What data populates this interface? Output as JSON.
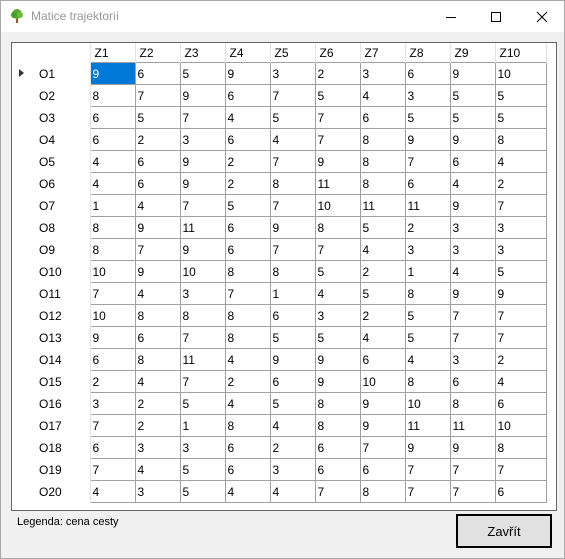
{
  "window": {
    "title": "Matice trajektorií"
  },
  "table": {
    "columns": [
      "Z1",
      "Z2",
      "Z3",
      "Z4",
      "Z5",
      "Z6",
      "Z7",
      "Z8",
      "Z9",
      "Z10"
    ],
    "rows": [
      {
        "label": "O1",
        "values": [
          "9",
          "6",
          "5",
          "9",
          "3",
          "2",
          "3",
          "6",
          "9",
          "10"
        ]
      },
      {
        "label": "O2",
        "values": [
          "8",
          "7",
          "9",
          "6",
          "7",
          "5",
          "4",
          "3",
          "5",
          "5"
        ]
      },
      {
        "label": "O3",
        "values": [
          "6",
          "5",
          "7",
          "4",
          "5",
          "7",
          "6",
          "5",
          "5",
          "5"
        ]
      },
      {
        "label": "O4",
        "values": [
          "6",
          "2",
          "3",
          "6",
          "4",
          "7",
          "8",
          "9",
          "9",
          "8"
        ]
      },
      {
        "label": "O5",
        "values": [
          "4",
          "6",
          "9",
          "2",
          "7",
          "9",
          "8",
          "7",
          "6",
          "4"
        ]
      },
      {
        "label": "O6",
        "values": [
          "4",
          "6",
          "9",
          "2",
          "8",
          "11",
          "8",
          "6",
          "4",
          "2"
        ]
      },
      {
        "label": "O7",
        "values": [
          "1",
          "4",
          "7",
          "5",
          "7",
          "10",
          "11",
          "11",
          "9",
          "7"
        ]
      },
      {
        "label": "O8",
        "values": [
          "8",
          "9",
          "11",
          "6",
          "9",
          "8",
          "5",
          "2",
          "3",
          "3"
        ]
      },
      {
        "label": "O9",
        "values": [
          "8",
          "7",
          "9",
          "6",
          "7",
          "7",
          "4",
          "3",
          "3",
          "3"
        ]
      },
      {
        "label": "O10",
        "values": [
          "10",
          "9",
          "10",
          "8",
          "8",
          "5",
          "2",
          "1",
          "4",
          "5"
        ]
      },
      {
        "label": "O11",
        "values": [
          "7",
          "4",
          "3",
          "7",
          "1",
          "4",
          "5",
          "8",
          "9",
          "9"
        ]
      },
      {
        "label": "O12",
        "values": [
          "10",
          "8",
          "8",
          "8",
          "6",
          "3",
          "2",
          "5",
          "7",
          "7"
        ]
      },
      {
        "label": "O13",
        "values": [
          "9",
          "6",
          "7",
          "8",
          "5",
          "5",
          "4",
          "5",
          "7",
          "7"
        ]
      },
      {
        "label": "O14",
        "values": [
          "6",
          "8",
          "11",
          "4",
          "9",
          "9",
          "6",
          "4",
          "3",
          "2"
        ]
      },
      {
        "label": "O15",
        "values": [
          "2",
          "4",
          "7",
          "2",
          "6",
          "9",
          "10",
          "8",
          "6",
          "4"
        ]
      },
      {
        "label": "O16",
        "values": [
          "3",
          "2",
          "5",
          "4",
          "5",
          "8",
          "9",
          "10",
          "8",
          "6"
        ]
      },
      {
        "label": "O17",
        "values": [
          "7",
          "2",
          "1",
          "8",
          "4",
          "8",
          "9",
          "11",
          "11",
          "10"
        ]
      },
      {
        "label": "O18",
        "values": [
          "6",
          "3",
          "3",
          "6",
          "2",
          "6",
          "7",
          "9",
          "9",
          "8"
        ]
      },
      {
        "label": "O19",
        "values": [
          "7",
          "4",
          "5",
          "6",
          "3",
          "6",
          "6",
          "7",
          "7",
          "7"
        ]
      },
      {
        "label": "O20",
        "values": [
          "4",
          "3",
          "5",
          "4",
          "4",
          "7",
          "8",
          "7",
          "7",
          "6"
        ]
      }
    ],
    "selected_cell": "O1/Z1"
  },
  "legend": {
    "text": "Legenda: cena cesty"
  },
  "buttons": {
    "close_label": "Zavřít"
  },
  "icons": {
    "app": "tree-icon",
    "minimize": "minimize-icon",
    "maximize": "maximize-icon",
    "close": "close-icon"
  },
  "colors": {
    "selection": "#0078d7",
    "grid_line": "#a0a0a0",
    "window_bg": "#f0f0f0"
  }
}
